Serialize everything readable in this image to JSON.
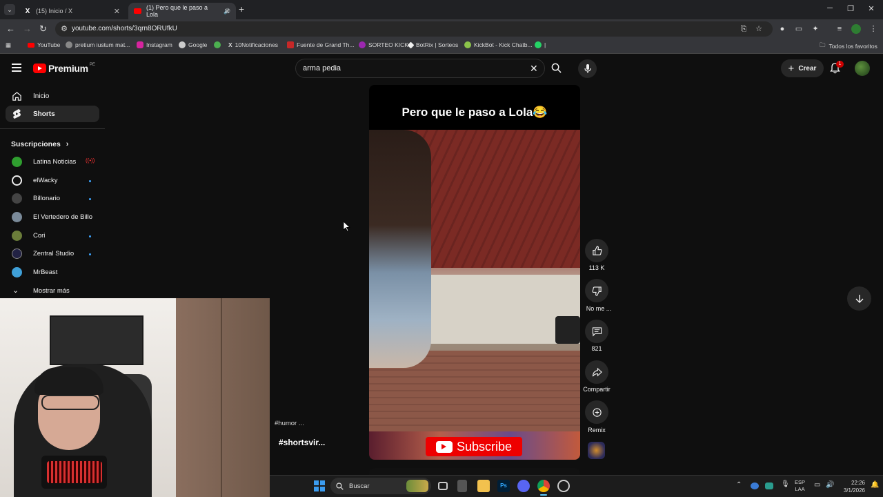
{
  "browser": {
    "tabs": [
      {
        "title": "(15) Inicio / X",
        "icon": "x-logo-icon"
      },
      {
        "title": "(1) Pero que le paso a Lola",
        "icon": "youtube-icon"
      }
    ],
    "url": "youtube.com/shorts/3qrn8ORUfkU",
    "bookmarks": [
      "YouTube",
      "pretium iustum mat...",
      "Instagram",
      "Google",
      "10Notificaciones",
      "Fuente de Grand Th...",
      "SORTEO KICK",
      "BotRix | Sorteos",
      "KickBot - Kick Chatb...",
      "|"
    ],
    "all_bookmarks": "Todos los favoritos"
  },
  "yt": {
    "logo": "Premium",
    "region": "PE",
    "search_value": "arma pedia",
    "create": "Crear",
    "notif_count": "1"
  },
  "sidebar": {
    "items": [
      {
        "label": "Inicio",
        "icon": "home-icon"
      },
      {
        "label": "Shorts",
        "icon": "shorts-icon"
      }
    ],
    "subs_title": "Suscripciones",
    "subs": [
      {
        "name": "Latina Noticias",
        "color": "#2f9e2f"
      },
      {
        "name": "elWacky",
        "color": "#eeeeee"
      },
      {
        "name": "Billonario",
        "color": "#333333"
      },
      {
        "name": "El Vertedero de Billo",
        "color": "#7a8a99"
      },
      {
        "name": "Cori",
        "color": "#6b7d3a"
      },
      {
        "name": "Zentral Studio",
        "color": "#222244"
      },
      {
        "name": "MrBeast",
        "color": "#3fa0d8"
      }
    ],
    "more": "Mostrar más"
  },
  "short": {
    "title": "Pero que le paso a Lola😂",
    "subscribe": "Subscribe",
    "tags": [
      "#humor ...",
      "#shortsvir..."
    ],
    "likes": "113 K",
    "dislike": "No me ...",
    "comments": "821",
    "share": "Compartir",
    "remix": "Remix"
  },
  "taskbar": {
    "search": "Buscar",
    "lang1": "ESP",
    "lang2": "LAA",
    "time": "22:26",
    "date": "3/1/2026"
  }
}
